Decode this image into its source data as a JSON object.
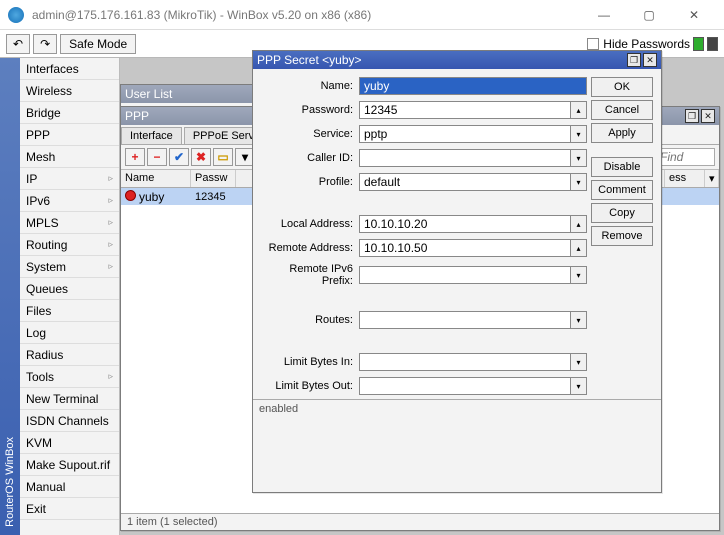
{
  "window": {
    "title": "admin@175.176.161.83 (MikroTik) - WinBox v5.20 on x86 (x86)"
  },
  "toolbar": {
    "undo_glyph": "↶",
    "redo_glyph": "↷",
    "safe_mode": "Safe Mode",
    "hide_passwords": "Hide Passwords"
  },
  "vtab_label": "RouterOS WinBox",
  "sidebar": {
    "items": [
      {
        "label": "Interfaces",
        "sub": false
      },
      {
        "label": "Wireless",
        "sub": false
      },
      {
        "label": "Bridge",
        "sub": false
      },
      {
        "label": "PPP",
        "sub": false
      },
      {
        "label": "Mesh",
        "sub": false
      },
      {
        "label": "IP",
        "sub": true
      },
      {
        "label": "IPv6",
        "sub": true
      },
      {
        "label": "MPLS",
        "sub": true
      },
      {
        "label": "Routing",
        "sub": true
      },
      {
        "label": "System",
        "sub": true
      },
      {
        "label": "Queues",
        "sub": false
      },
      {
        "label": "Files",
        "sub": false
      },
      {
        "label": "Log",
        "sub": false
      },
      {
        "label": "Radius",
        "sub": false
      },
      {
        "label": "Tools",
        "sub": true
      },
      {
        "label": "New Terminal",
        "sub": false
      },
      {
        "label": "ISDN Channels",
        "sub": false
      },
      {
        "label": "KVM",
        "sub": false
      },
      {
        "label": "Make Supout.rif",
        "sub": false
      },
      {
        "label": "Manual",
        "sub": false
      },
      {
        "label": "Exit",
        "sub": false
      }
    ]
  },
  "userlist": {
    "title": "User List"
  },
  "pppwin": {
    "title": "PPP",
    "tabs": [
      "Interface",
      "PPPoE Servers"
    ],
    "find_placeholder": "Find",
    "columns": [
      "Name",
      "Passw",
      "ess"
    ],
    "rows": [
      {
        "name": "yuby",
        "password": "12345"
      }
    ],
    "status": "1 item (1 selected)",
    "icons": {
      "plus": "+",
      "minus": "−",
      "check": "✔",
      "cross": "✖",
      "notes": "▭",
      "funnel": "▾"
    }
  },
  "secret": {
    "title": "PPP Secret <yuby>",
    "fields": {
      "name_label": "Name:",
      "name_value": "yuby",
      "password_label": "Password:",
      "password_value": "12345",
      "service_label": "Service:",
      "service_value": "pptp",
      "caller_label": "Caller ID:",
      "caller_value": "",
      "profile_label": "Profile:",
      "profile_value": "default",
      "local_label": "Local Address:",
      "local_value": "10.10.10.20",
      "remote_label": "Remote Address:",
      "remote_value": "10.10.10.50",
      "remote6_label": "Remote IPv6 Prefix:",
      "remote6_value": "",
      "routes_label": "Routes:",
      "routes_value": "",
      "limitin_label": "Limit Bytes In:",
      "limitin_value": "",
      "limitout_label": "Limit Bytes Out:",
      "limitout_value": ""
    },
    "buttons": {
      "ok": "OK",
      "cancel": "Cancel",
      "apply": "Apply",
      "disable": "Disable",
      "comment": "Comment",
      "copy": "Copy",
      "remove": "Remove"
    },
    "status": "enabled"
  }
}
